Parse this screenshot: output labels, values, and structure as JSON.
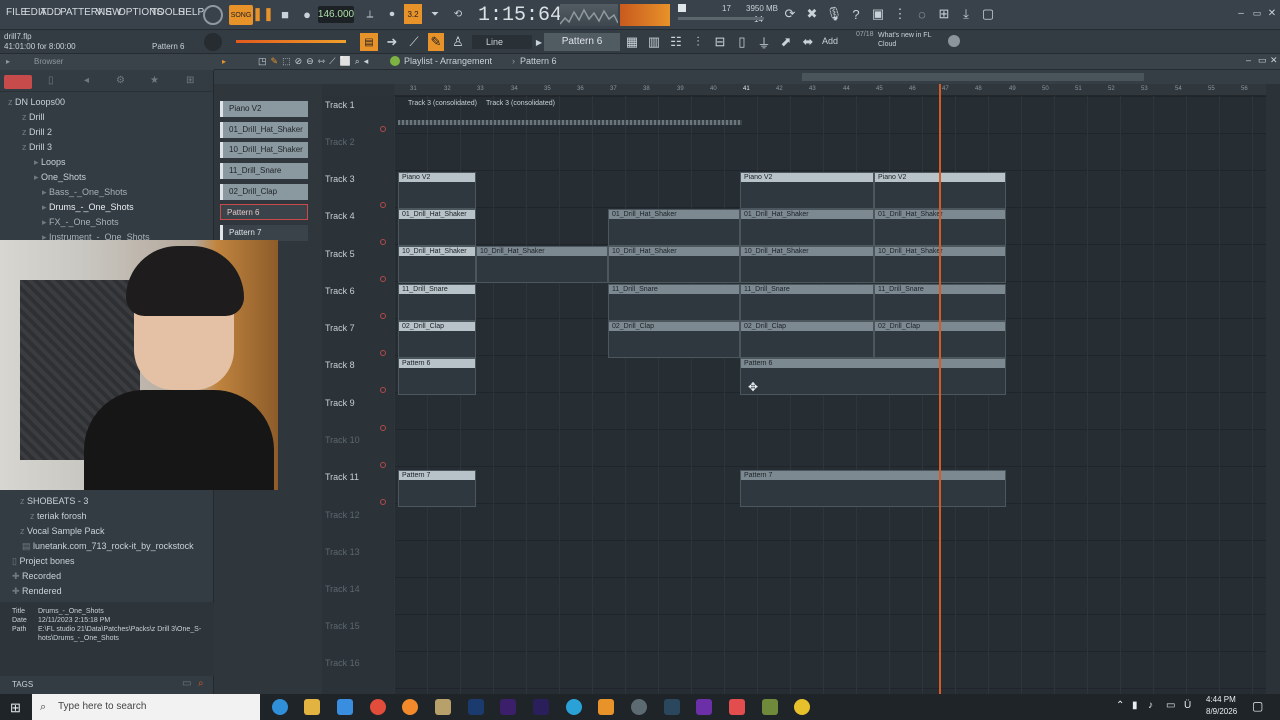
{
  "menu": [
    "FILE",
    "EDIT",
    "ADD",
    "PATTERNS",
    "VIEW",
    "OPTIONS",
    "TOOLS",
    "HELP"
  ],
  "transport": {
    "song_label": "SONG",
    "tempo": "146.000",
    "time": "1:15:64",
    "cpu": "17",
    "memory": "3950 MB",
    "poly": "14"
  },
  "project": {
    "file": "drill7.flp",
    "position": "41:01:00 for 8:00:00",
    "pattern_hint": "Pattern 6"
  },
  "toolbar": {
    "snap": "Line",
    "pattern": "Pattern 6",
    "add": "Add",
    "news_count": "07/18",
    "news": "What's new in FL Cloud"
  },
  "browser": {
    "title": "Browser",
    "items": [
      {
        "label": "DN Loops00",
        "indent": 1
      },
      {
        "label": "Drill",
        "indent": 1
      },
      {
        "label": "Drill 2",
        "indent": 1
      },
      {
        "label": "Drill 3",
        "indent": 1
      },
      {
        "label": "Loops",
        "indent": 2
      },
      {
        "label": "One_Shots",
        "indent": 2
      },
      {
        "label": "Bass_-_One_Shots",
        "indent": 3
      },
      {
        "label": "Drums_-_One_Shots",
        "indent": 3
      },
      {
        "label": "FX_-_One_Shots",
        "indent": 3
      },
      {
        "label": "Instrument_-_One_Shots",
        "indent": 3
      }
    ],
    "lower_items": [
      {
        "label": "SHOBEATS - 3"
      },
      {
        "label": "teriak forosh"
      },
      {
        "label": "Vocal Sample Pack"
      },
      {
        "label": "lunetank.com_713_rock-it_by_rockstock"
      },
      {
        "label": "Project bones"
      },
      {
        "label": "Recorded"
      },
      {
        "label": "Rendered"
      }
    ],
    "info": {
      "title_key": "Title",
      "title": "Drums_-_One_Shots",
      "date_key": "Date",
      "date": "12/11/2023 2:15:18 PM",
      "path_key": "Path",
      "path1": "E:\\FL studio 21\\Data\\Patches\\Packs\\z  Drill 3\\One_S-",
      "path2": "hots\\Drums_-_One_Shots"
    },
    "tags": "TAGS"
  },
  "channels": [
    "Piano V2",
    "01_Drill_Hat_Shaker",
    "10_Drill_Hat_Shaker",
    "11_Drill_Snare",
    "02_Drill_Clap",
    "Pattern 6",
    "Pattern 7"
  ],
  "playlist": {
    "title": "Playlist - Arrangement",
    "pattern": "Pattern 6"
  },
  "ruler": [
    "31",
    "32",
    "33",
    "34",
    "35",
    "36",
    "37",
    "38",
    "39",
    "40",
    "41",
    "42",
    "43",
    "44",
    "45",
    "46",
    "47",
    "48",
    "49",
    "50",
    "51",
    "52",
    "53",
    "54",
    "55",
    "56"
  ],
  "tracks": [
    "Track 1",
    "Track 2",
    "Track 3",
    "Track 4",
    "Track 5",
    "Track 6",
    "Track 7",
    "Track 8",
    "Track 9",
    "Track 10",
    "Track 11",
    "Track 12",
    "Track 13",
    "Track 14",
    "Track 15",
    "Track 16"
  ],
  "clips": {
    "audio1": "Track 3 (consolidated)",
    "audio2": "Track 3 (consolidated)",
    "piano": "Piano V2",
    "hat1": "01_Drill_Hat_Shaker",
    "hat10": "10_Drill_Hat_Shaker",
    "snare": "11_Drill_Snare",
    "clap": "02_Drill_Clap",
    "p6": "Pattern 6",
    "p7": "Pattern 7"
  },
  "taskbar": {
    "search": "Type here to search",
    "time": "4:44 PM",
    "date": "8/9/2026"
  }
}
